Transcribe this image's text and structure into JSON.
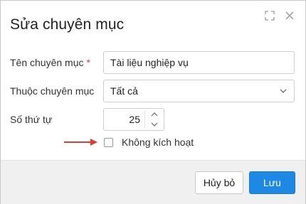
{
  "dialog": {
    "title": "Sửa chuyên mục",
    "header_icons": [
      "expand-icon",
      "close-icon"
    ]
  },
  "form": {
    "name_label": "Tên chuyên mục",
    "required_mark": "*",
    "name_value": "Tài liệu nghiệp vụ",
    "parent_label": "Thuộc chuyên mục",
    "parent_value": "Tất cả",
    "order_label": "Số thứ tự",
    "order_value": "25",
    "inactive_label": "Không kích hoạt",
    "inactive_checked": false
  },
  "footer": {
    "cancel_label": "Hủy bỏ",
    "save_label": "Lưu"
  },
  "colors": {
    "primary": "#1e88e5",
    "required": "#e53935",
    "annotation_arrow": "#e53935"
  }
}
